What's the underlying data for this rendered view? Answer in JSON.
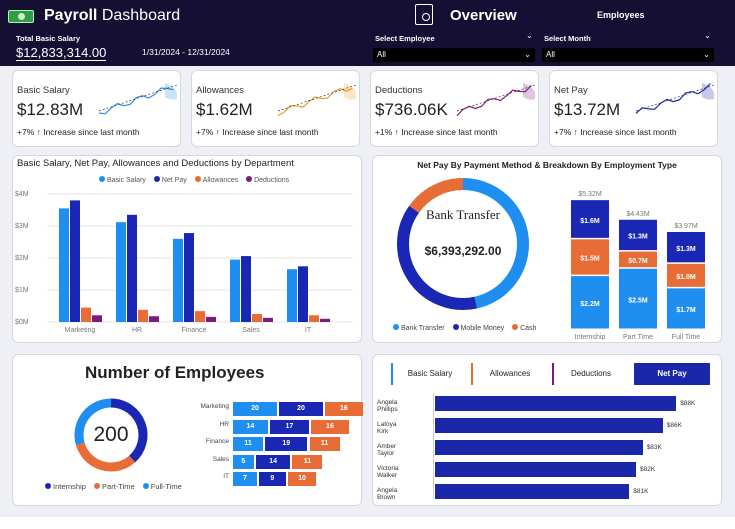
{
  "header": {
    "title_bold": "Payroll",
    "title_rest": "Dashboard",
    "overview": "Overview",
    "employees": "Employees",
    "total_label": "Total Basic Salary",
    "total_value": "$12,833,314.00",
    "date_range": "1/31/2024 - 12/31/2024"
  },
  "filters": [
    {
      "label": "Select Employee",
      "value": "All"
    },
    {
      "label": "Select Month",
      "value": "All"
    }
  ],
  "kpis": [
    {
      "title": "Basic Salary",
      "value": "$12.83M",
      "sub": "+7% ↑ Increase since last month",
      "color": "#2e8be8"
    },
    {
      "title": "Allowances",
      "value": "$1.62M",
      "sub": "+7% ↑ Increase since last month",
      "color": "#e8a020"
    },
    {
      "title": "Deductions",
      "value": "$736.06K",
      "sub": "+1% ↑ Increase since last month",
      "color": "#7b1c7c"
    },
    {
      "title": "Net Pay",
      "value": "$13.72M",
      "sub": "+7% ↑ Increase since last month",
      "color": "#1a27a8"
    }
  ],
  "colors": {
    "basic": "#1f8ef1",
    "net": "#1a27b4",
    "allow": "#e86c35",
    "deduct": "#7b1c7c"
  },
  "chart_data": [
    {
      "type": "bar",
      "title": "Basic Salary, Net Pay, Allowances and Deductions by Department",
      "categories": [
        "Marketing",
        "HR",
        "Finance",
        "Sales",
        "IT"
      ],
      "ylim": [
        0,
        4000000
      ],
      "yticks": [
        "$0M",
        "$1M",
        "$2M",
        "$3M",
        "$4M"
      ],
      "series": [
        {
          "name": "Basic Salary",
          "values": [
            3550000,
            3120000,
            2600000,
            1950000,
            1650000
          ]
        },
        {
          "name": "Net Pay",
          "values": [
            3800000,
            3350000,
            2780000,
            2060000,
            1740000
          ]
        },
        {
          "name": "Allowances",
          "values": [
            450000,
            380000,
            340000,
            250000,
            210000
          ]
        },
        {
          "name": "Deductions",
          "values": [
            210000,
            180000,
            160000,
            130000,
            100000
          ]
        }
      ]
    },
    {
      "type": "pie",
      "title": "Net Pay By Payment Method & Breakdown By Employment Type",
      "center_label": "Bank Transfer",
      "center_value": "$6,393,292.00",
      "legend": [
        "Bank Transfer",
        "Mobile Money",
        "Cash"
      ],
      "values": [
        6393292,
        5250000,
        2080000
      ]
    },
    {
      "type": "bar",
      "categories": [
        "Internship",
        "Part Time",
        "Full Time"
      ],
      "totals": [
        "$5.32M",
        "$4.43M",
        "$3.97M"
      ],
      "series": [
        {
          "name": "Full-Time",
          "values": [
            2.2,
            2.5,
            1.7
          ],
          "labels": [
            "$2.2M",
            "$2.5M",
            "$1.7M"
          ]
        },
        {
          "name": "Part-Time",
          "values": [
            1.5,
            0.7,
            1.0
          ],
          "labels": [
            "$1.5M",
            "$0.7M",
            "$1.0M"
          ]
        },
        {
          "name": "Internship",
          "values": [
            1.6,
            1.3,
            1.3
          ],
          "labels": [
            "$1.6M",
            "$1.3M",
            "$1.3M"
          ]
        }
      ]
    },
    {
      "type": "pie",
      "title": "Number of Employees",
      "center_value": "200",
      "legend": [
        "Internship",
        "Part-Time",
        "Full-Time"
      ],
      "values": [
        77,
        64,
        59
      ]
    },
    {
      "type": "bar",
      "categories": [
        "Marketing",
        "HR",
        "Finance",
        "Sales",
        "IT"
      ],
      "series": [
        {
          "name": "Full-Time",
          "values": [
            20,
            14,
            11,
            5,
            7
          ]
        },
        {
          "name": "Internship",
          "values": [
            20,
            17,
            19,
            14,
            9
          ]
        },
        {
          "name": "Part-Time",
          "values": [
            16,
            16,
            11,
            11,
            10
          ]
        }
      ]
    },
    {
      "type": "bar",
      "categories": [
        "Angela Phillips",
        "Latoya Kirk",
        "Amber Taylor",
        "Victoria Walker",
        "Angela Brown"
      ],
      "values": [
        88,
        86,
        83,
        82,
        81
      ],
      "labels": [
        "$88K",
        "$86K",
        "$83K",
        "$82K",
        "$81K"
      ]
    }
  ],
  "tabs": [
    "Basic Salary",
    "Allowances",
    "Deductions",
    "Net Pay"
  ]
}
